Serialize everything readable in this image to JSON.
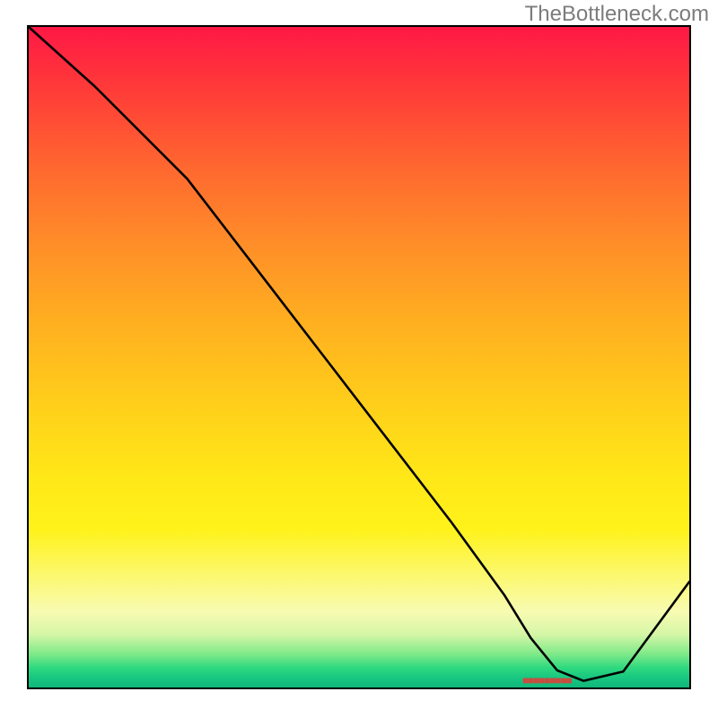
{
  "watermark": "TheBottleneck.com",
  "marker_text": "■■■■■■■■■",
  "chart_data": {
    "type": "line",
    "title": "",
    "xlabel": "",
    "ylabel": "",
    "x_range": [
      0,
      100
    ],
    "y_range": [
      0,
      100
    ],
    "series": [
      {
        "name": "curve",
        "x": [
          0,
          10,
          22,
          24,
          34,
          44,
          54,
          64,
          72,
          76,
          80,
          84,
          90,
          100
        ],
        "y": [
          100,
          91,
          79,
          77,
          64,
          51,
          38,
          25,
          14,
          7.5,
          2.6,
          1.0,
          2.4,
          16
        ]
      }
    ],
    "legend": false,
    "optimum_x_range": [
      76,
      84
    ]
  }
}
